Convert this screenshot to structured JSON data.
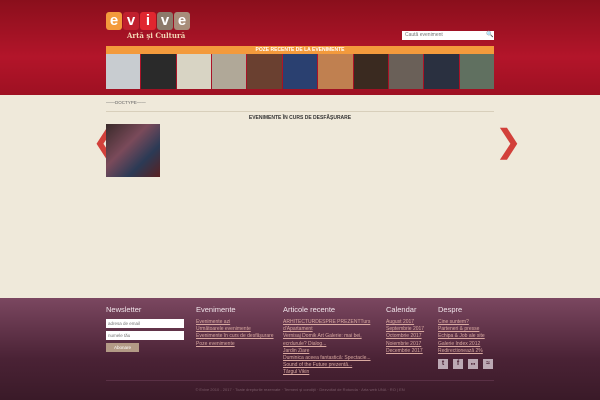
{
  "header": {
    "logo_letters": [
      "e",
      "v",
      "i",
      "v",
      "e"
    ],
    "logo_colors": [
      "#f39a3c",
      "#b3152a",
      "#d9232f",
      "#8c7a6b",
      "#a88d7a"
    ],
    "tagline": "Artă şi Cultură",
    "search_placeholder": "Caută eveniment",
    "strip_title": "POZE RECENTE DE LA EVENIMENTE"
  },
  "main": {
    "doctype": "DOCTYPE",
    "current_title": "EVENIMENTE ÎN CURS DE DESFĂŞURARE",
    "prev": "❮",
    "next": "❯"
  },
  "footer": {
    "newsletter": {
      "title": "Newsletter",
      "email_placeholder": "adresa de email",
      "name_placeholder": "numele tău",
      "button": "Abonare"
    },
    "events": {
      "title": "Evenimente",
      "links": [
        "Evenimente azi",
        "Următoarele evenimente",
        "Evenimente în curs de desfăşurare",
        "Poze evenimente"
      ]
    },
    "articles": {
      "title": "Articole recente",
      "links": [
        "ARHITECTURDESPRE PREZENTTurs",
        "d'Apartament",
        "Vernisaj Domik Art Galerie: mai bei,",
        "ecrdurule? Dialog...",
        "Jardin Ziare",
        "Duminica aceea fantastică: Spectacle...",
        "Sound of the Future prezentă...",
        "Târgul Vikin"
      ]
    },
    "calendar": {
      "title": "Calendar",
      "links": [
        "August 2017",
        "Septembrie 2017",
        "Octombrie 2017",
        "Noiembrie 2017",
        "Decembrie 2017"
      ]
    },
    "about": {
      "title": "Despre",
      "links": [
        "Cine suntem?",
        "Parteneri & presse",
        "Echipa & Job ale site",
        "Galerie Index 2012",
        "Redirectionează 2%"
      ]
    },
    "social": [
      "t",
      "f",
      "●●",
      "≈"
    ],
    "copyright": "© Evive 2010 - 2017 · Toate drepturile rezervate · Termeni şi condiţii · Dezvoltat de Rotunda · Arta web UNA · RO | EN"
  }
}
